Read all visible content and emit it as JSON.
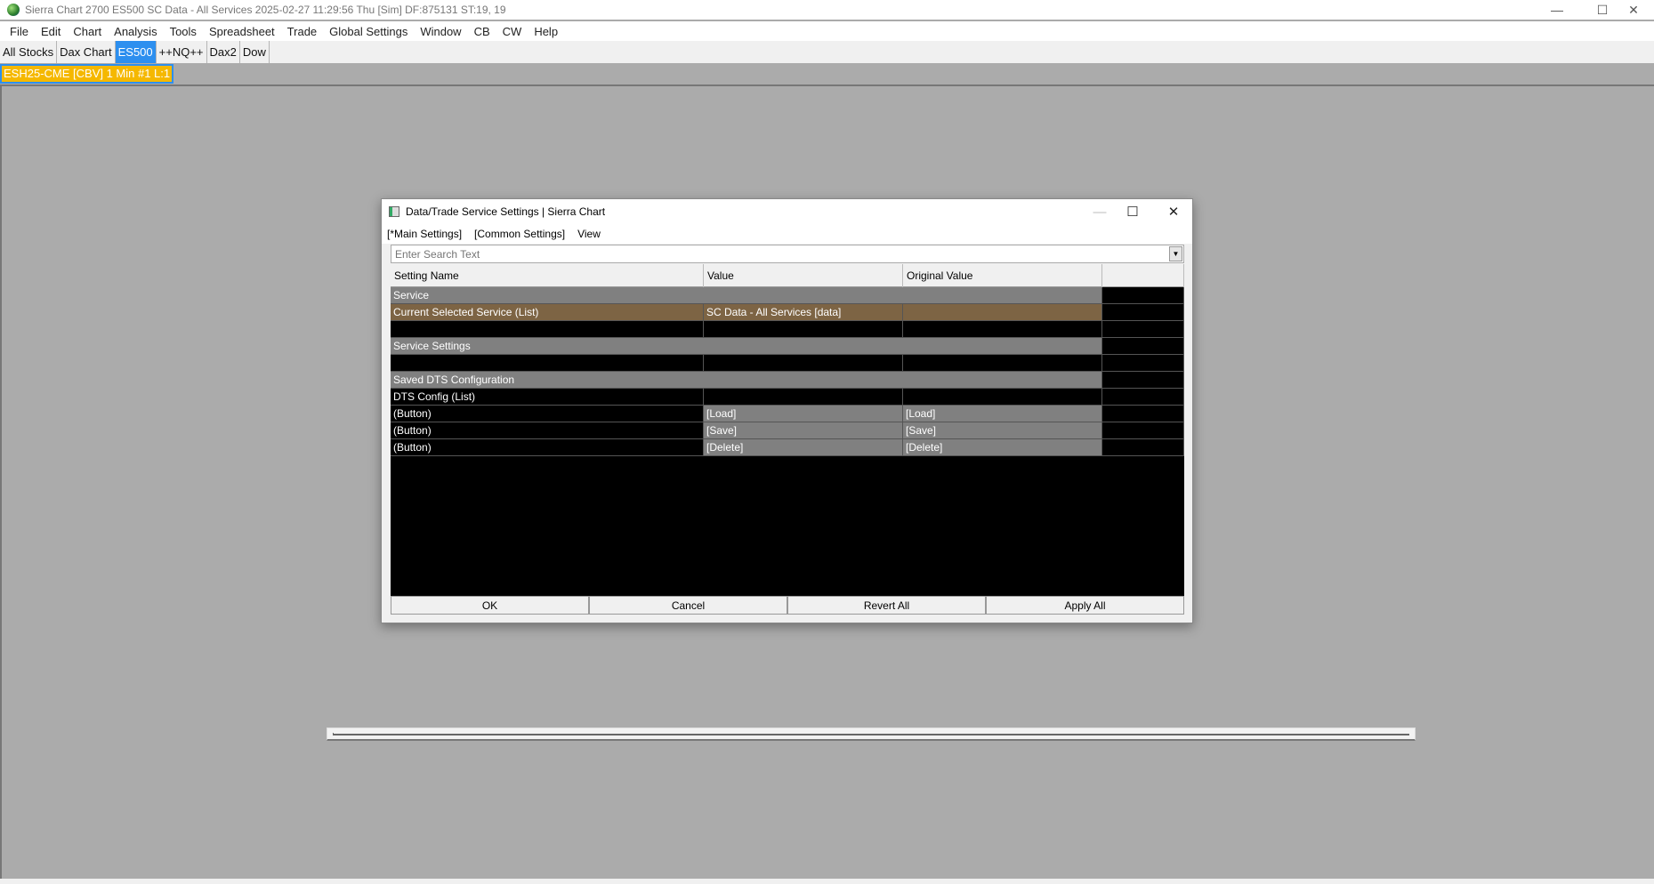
{
  "app": {
    "title": "Sierra Chart 2700 ES500 SC Data - All Services 2025-02-27  11:29:56 Thu [Sim] DF:875131  ST:19, 19"
  },
  "menu": [
    "File",
    "Edit",
    "Chart",
    "Analysis",
    "Tools",
    "Spreadsheet",
    "Trade",
    "Global Settings",
    "Window",
    "CB",
    "CW",
    "Help"
  ],
  "tabs": [
    "All Stocks",
    "Dax Chart",
    "ES500",
    "++NQ++",
    "Dax2",
    "Dow"
  ],
  "active_tab": "ES500",
  "chart_tab": "ESH25-CME [CBV]  1 Min  #1 L:1",
  "dialog": {
    "title": "Data/Trade Service Settings | Sierra Chart",
    "menu": [
      "[*Main Settings]",
      "[Common Settings]",
      "View"
    ],
    "search_placeholder": "Enter Search Text",
    "columns": [
      "Setting Name",
      "Value",
      "Original Value"
    ],
    "rows": [
      {
        "name": "Service",
        "value": "",
        "original": ""
      },
      {
        "name": "Current Selected Service (List)",
        "value": "SC Data - All Services    [data]",
        "original": ""
      },
      {
        "name": "",
        "value": "",
        "original": ""
      },
      {
        "name": "Service Settings",
        "value": "",
        "original": ""
      },
      {
        "name": "",
        "value": "",
        "original": ""
      },
      {
        "name": "Saved DTS Configuration",
        "value": "",
        "original": ""
      },
      {
        "name": "DTS Config (List)",
        "value": "",
        "original": ""
      },
      {
        "name": " (Button)",
        "value": "[Load]",
        "original": "[Load]"
      },
      {
        "name": " (Button)",
        "value": "[Save]",
        "original": "[Save]"
      },
      {
        "name": " (Button)",
        "value": "[Delete]",
        "original": "[Delete]"
      }
    ],
    "buttons": [
      "OK",
      "Cancel",
      "Revert All",
      "Apply All"
    ]
  }
}
